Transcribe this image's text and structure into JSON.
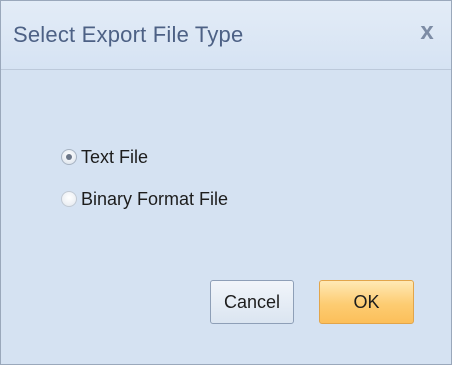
{
  "dialog": {
    "title": "Select Export File Type",
    "close_glyph": "x"
  },
  "options": [
    {
      "label": "Text File",
      "checked": true
    },
    {
      "label": "Binary Format File",
      "checked": false
    }
  ],
  "buttons": {
    "cancel_label": "Cancel",
    "ok_label": "OK"
  },
  "colors": {
    "dialog_background": "#d5e2f2",
    "title_text": "#4d6185",
    "ok_button": "#fdcc72"
  }
}
